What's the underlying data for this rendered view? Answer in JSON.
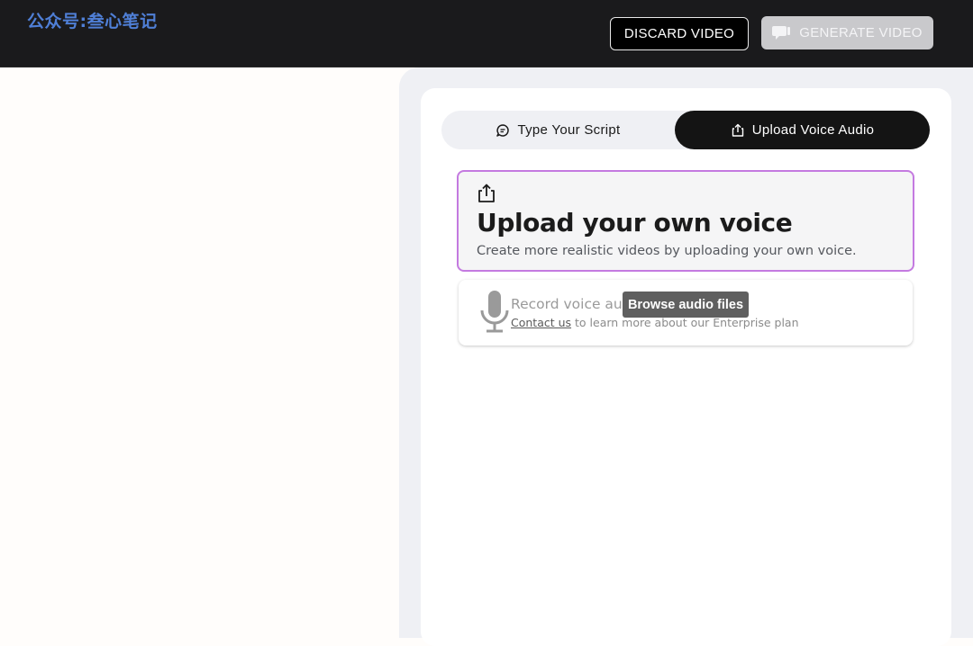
{
  "header": {
    "watermark": "公众号:叁心笔记",
    "discard_label": "DISCARD VIDEO",
    "generate_label": "GENERATE VIDEO"
  },
  "tabs": [
    {
      "label": "Type Your Script",
      "icon": "message-icon",
      "active": false
    },
    {
      "label": "Upload Voice Audio",
      "icon": "upload-icon",
      "active": true
    }
  ],
  "upload_card": {
    "icon": "upload-icon",
    "title": "Upload your own voice",
    "subtitle": "Create more realistic videos by uploading your own voice."
  },
  "record_card": {
    "icon": "microphone-icon",
    "label": "Record voice audio",
    "contact_link": "Contact us",
    "contact_rest": " to learn more about our Enterprise plan"
  },
  "tooltip": {
    "text": "Browse audio files"
  },
  "colors": {
    "topbar": "#1a1a1c",
    "accent_border": "#c47ae0",
    "active_tab": "#141414",
    "panel_bg": "#eff0f4"
  }
}
